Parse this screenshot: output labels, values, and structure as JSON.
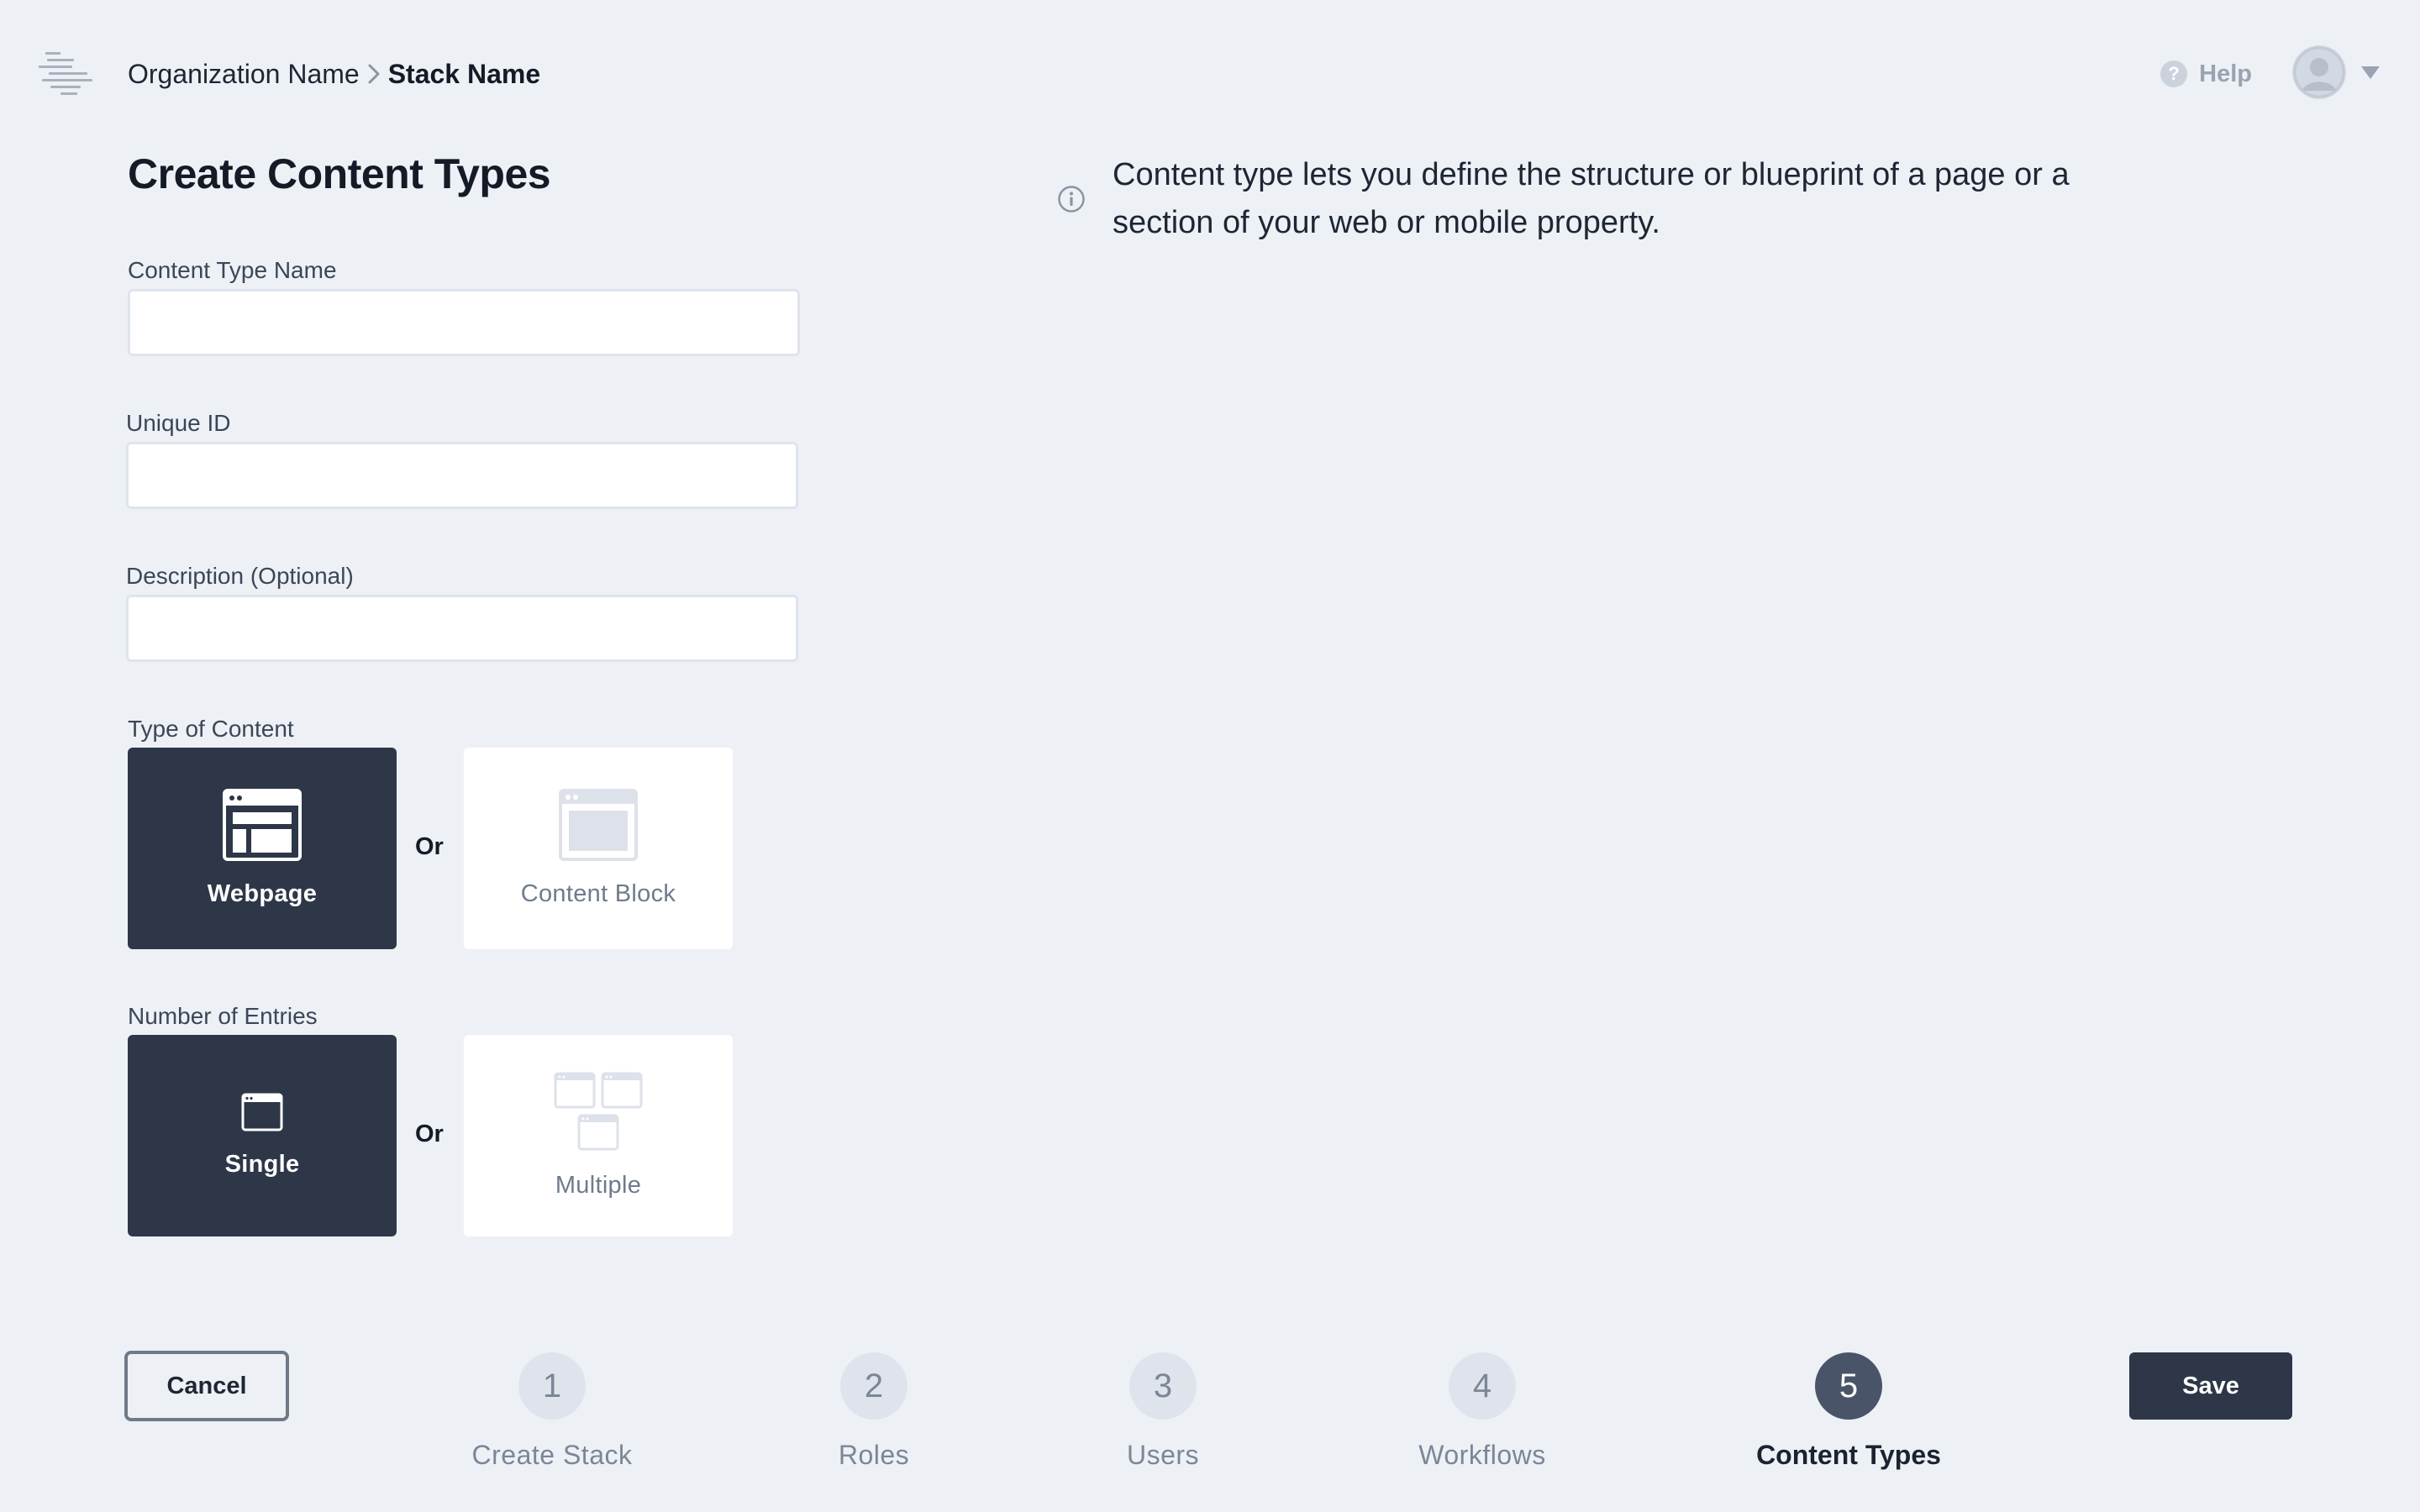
{
  "header": {
    "logo_icon": "contentstack-logo-icon",
    "breadcrumb": {
      "org": "Organization Name",
      "stack": "Stack Name"
    },
    "help_label": "Help",
    "help_icon": "help-icon",
    "avatar_icon": "user-avatar-icon"
  },
  "page": {
    "title": "Create Content Types",
    "info": "Content type lets you define the structure or blueprint of a page or a section of your web or mobile property."
  },
  "form": {
    "name_label": "Content Type Name",
    "name_value": "",
    "uid_label": "Unique ID",
    "uid_value": "",
    "description_label": "Description (Optional)",
    "description_value": "",
    "type_label": "Type of Content",
    "type_options": [
      {
        "label": "Webpage",
        "icon": "webpage-icon",
        "selected": true
      },
      {
        "label": "Content Block",
        "icon": "content-block-icon",
        "selected": false
      }
    ],
    "entries_label": "Number of Entries",
    "entries_options": [
      {
        "label": "Single",
        "icon": "single-entry-icon",
        "selected": true
      },
      {
        "label": "Multiple",
        "icon": "multiple-entries-icon",
        "selected": false
      }
    ],
    "or_text": "Or"
  },
  "footer": {
    "cancel_label": "Cancel",
    "save_label": "Save",
    "steps": [
      {
        "number": "1",
        "label": "Create Stack"
      },
      {
        "number": "2",
        "label": "Roles"
      },
      {
        "number": "3",
        "label": "Users"
      },
      {
        "number": "4",
        "label": "Workflows"
      },
      {
        "number": "5",
        "label": "Content Types",
        "active": true
      }
    ]
  },
  "colors": {
    "background": "#edf1f6",
    "dark": "#2d3748",
    "step_active": "#4a5468",
    "step_inactive": "#dfe4ec"
  }
}
